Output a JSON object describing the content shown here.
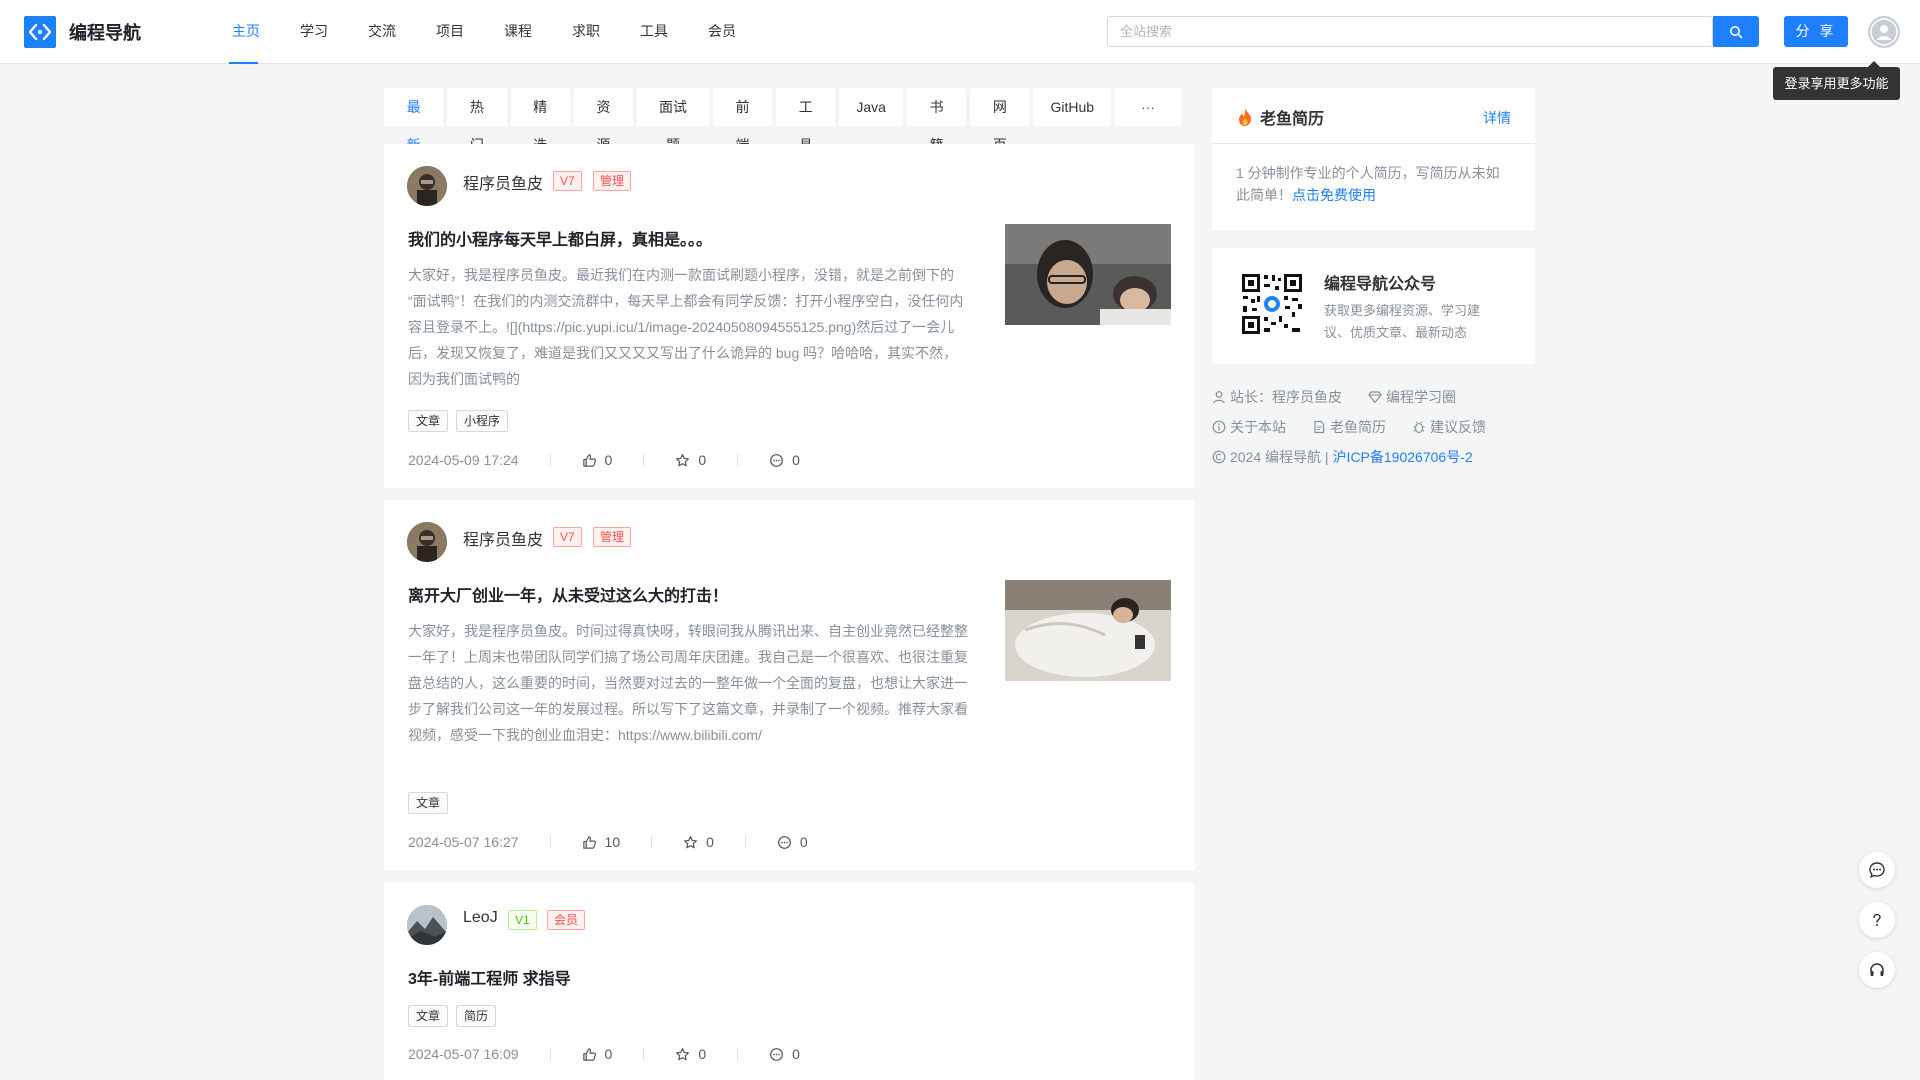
{
  "header": {
    "logo_text": "编程导航",
    "nav": [
      "主页",
      "学习",
      "交流",
      "项目",
      "课程",
      "求职",
      "工具",
      "会员"
    ],
    "search_placeholder": "全站搜索",
    "share_label": "分 享",
    "tooltip": "登录享用更多功能"
  },
  "tabs": [
    "最新",
    "热门",
    "精选",
    "资源",
    "面试题",
    "前端",
    "工具",
    "Java",
    "书籍",
    "网页",
    "GitHub",
    "···"
  ],
  "posts": [
    {
      "author": "程序员鱼皮",
      "level": "V7",
      "role": "管理",
      "title": "我们的小程序每天早上都白屏，真相是。。。",
      "excerpt": "大家好，我是程序员鱼皮。最近我们在内测一款面试刷题小程序，没错，就是之前倒下的 “面试鸭”！在我们的内测交流群中，每天早上都会有同学反馈：打开小程序空白，没任何内容且登录不上。![](https://pic.yupi.icu/1/image-20240508094555125.png)然后过了一会儿后，发现又恢复了，难道是我们又又又又写出了什么诡异的 bug 吗？哈哈哈，其实不然，因为我们面试鸭的",
      "tags": [
        "文章",
        "小程序"
      ],
      "time": "2024-05-09 17:24",
      "likes": "0",
      "stars": "0",
      "comments": "0"
    },
    {
      "author": "程序员鱼皮",
      "level": "V7",
      "role": "管理",
      "title": "离开大厂创业一年，从未受过这么大的打击！",
      "excerpt": "大家好，我是程序员鱼皮。时间过得真快呀，转眼间我从腾讯出来、自主创业竟然已经整整一年了！上周末也带团队同学们搞了场公司周年庆团建。我自己是一个很喜欢、也很注重复盘总结的人，这么重要的时间，当然要对过去的一整年做一个全面的复盘，也想让大家进一步了解我们公司这一年的发展过程。所以写下了这篇文章，并录制了一个视频。推荐大家看视频，感受一下我的创业血泪史：https://www.bilibili.com/",
      "tags": [
        "文章"
      ],
      "time": "2024-05-07 16:27",
      "likes": "10",
      "stars": "0",
      "comments": "0"
    },
    {
      "author": "LeoJ",
      "level": "V1",
      "role": "会员",
      "title": "3年-前端工程师 求指导",
      "tags": [
        "文章",
        "简历"
      ],
      "time": "2024-05-07 16:09",
      "likes": "0",
      "stars": "0",
      "comments": "0"
    }
  ],
  "sidebar": {
    "resume_card": {
      "title": "老鱼简历",
      "detail": "详情",
      "desc": "1 分钟制作专业的个人简历，写简历从未如此简单！",
      "link": "点击免费使用"
    },
    "wechat_card": {
      "title": "编程导航公众号",
      "desc": "获取更多编程资源、学习建议、优质文章、最新动态"
    },
    "footer": {
      "owner": "站长：程序员鱼皮",
      "circle": "编程学习圈",
      "about": "关于本站",
      "resume": "老鱼简历",
      "feedback": "建议反馈",
      "copyright": "2024 编程导航 |",
      "icp": "沪ICP备19026706号-2"
    }
  },
  "colors": {
    "accent": "#1e80ff",
    "danger": "#ff4d4f",
    "success": "#52c41a"
  }
}
